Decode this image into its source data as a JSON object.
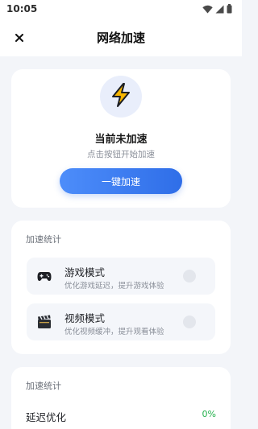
{
  "status_bar": {
    "time": "10:05",
    "icons": [
      "wifi-icon",
      "signal-icon",
      "battery-icon"
    ]
  },
  "nav": {
    "title": "网络加速",
    "close_icon": "close-icon"
  },
  "accelerate": {
    "icon": "lightning-bolt-icon",
    "status": "当前未加速",
    "hint": "点击按钮开始加速",
    "button_label": "一键加速"
  },
  "stats": {
    "title": "加速统计",
    "modes": [
      {
        "icon": "gamepad-icon",
        "title": "游戏模式",
        "description": "优化游戏延迟，提升游戏体验"
      },
      {
        "icon": "clapperboard-icon",
        "title": "视频模式",
        "description": "优化视频缓冲，提升观看体验"
      }
    ]
  },
  "latency": {
    "title": "加速统计",
    "label": "延迟优化",
    "value": "0%"
  },
  "colors": {
    "accent": "#3b7cf0",
    "bolt_yellow": "#f7b500",
    "success_green": "#22b04b",
    "background": "#f3f5f9"
  }
}
